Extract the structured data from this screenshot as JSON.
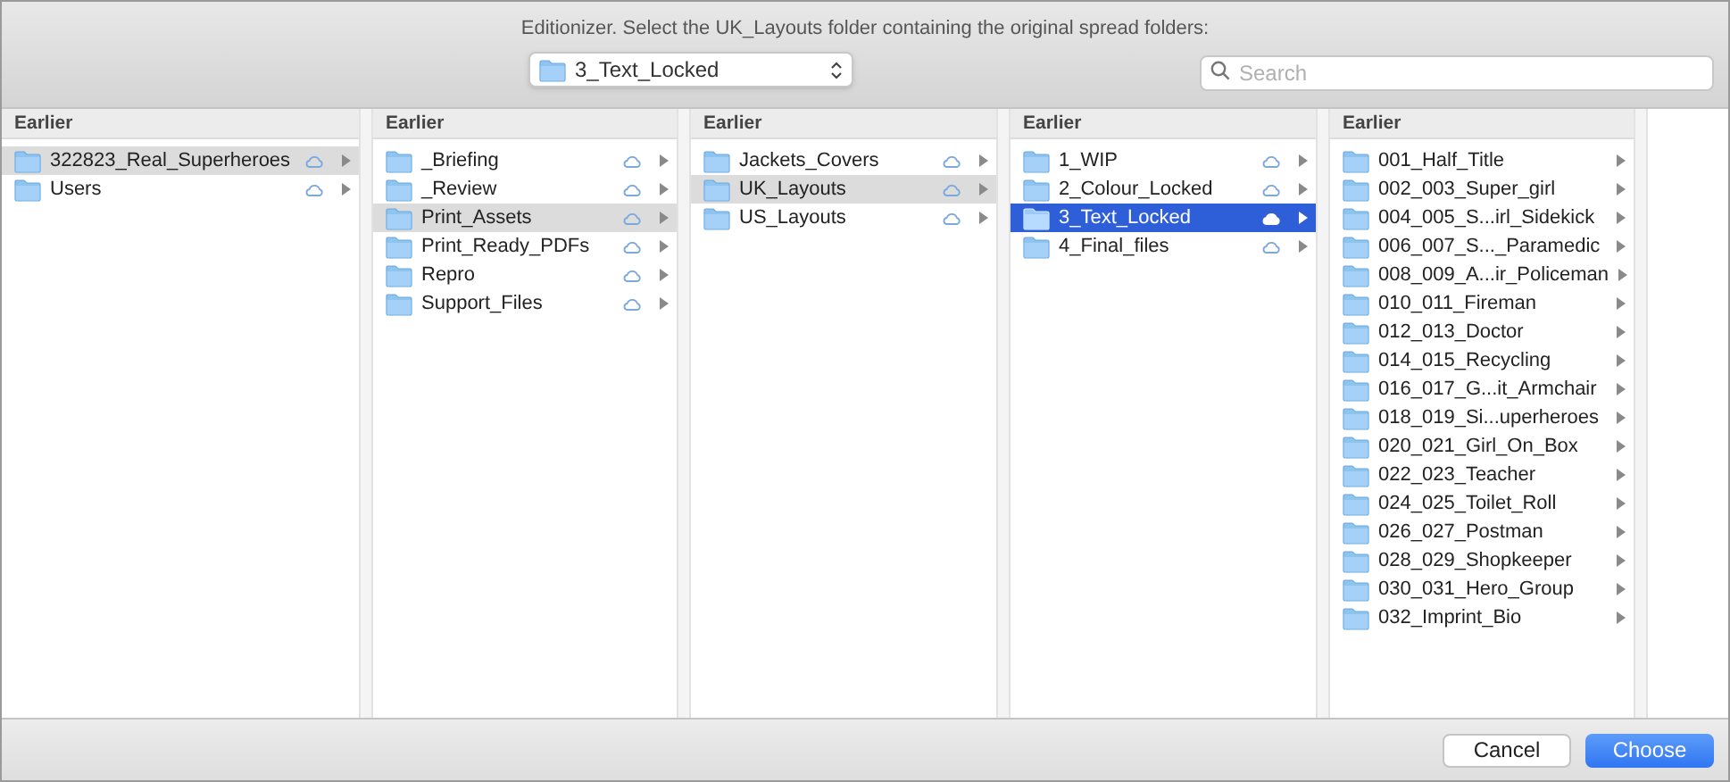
{
  "prompt": "Editionizer. Select the UK_Layouts folder containing the original spread folders:",
  "location_popup": {
    "value": "3_Text_Locked"
  },
  "search": {
    "placeholder": "Search"
  },
  "columns": [
    {
      "header": "Earlier",
      "focused": false,
      "items": [
        {
          "name": "322823_Real_Superheroes",
          "cloud": true,
          "selected": true
        },
        {
          "name": "Users",
          "cloud": true,
          "selected": false
        }
      ]
    },
    {
      "header": "Earlier",
      "focused": false,
      "items": [
        {
          "name": "_Briefing",
          "cloud": true,
          "selected": false
        },
        {
          "name": "_Review",
          "cloud": true,
          "selected": false
        },
        {
          "name": "Print_Assets",
          "cloud": true,
          "selected": true
        },
        {
          "name": "Print_Ready_PDFs",
          "cloud": true,
          "selected": false
        },
        {
          "name": "Repro",
          "cloud": true,
          "selected": false
        },
        {
          "name": "Support_Files",
          "cloud": true,
          "selected": false
        }
      ]
    },
    {
      "header": "Earlier",
      "focused": false,
      "items": [
        {
          "name": "Jackets_Covers",
          "cloud": true,
          "selected": false
        },
        {
          "name": "UK_Layouts",
          "cloud": true,
          "selected": true
        },
        {
          "name": "US_Layouts",
          "cloud": true,
          "selected": false
        }
      ]
    },
    {
      "header": "Earlier",
      "focused": true,
      "items": [
        {
          "name": "1_WIP",
          "cloud": true,
          "selected": false
        },
        {
          "name": "2_Colour_Locked",
          "cloud": true,
          "selected": false
        },
        {
          "name": "3_Text_Locked",
          "cloud": true,
          "selected": true
        },
        {
          "name": "4_Final_files",
          "cloud": true,
          "selected": false
        }
      ]
    },
    {
      "header": "Earlier",
      "items": [
        {
          "name": "001_Half_Title",
          "cloud": false,
          "selected": false
        },
        {
          "name": "002_003_Super_girl",
          "cloud": false,
          "selected": false
        },
        {
          "name": "004_005_S...irl_Sidekick",
          "cloud": false,
          "selected": false
        },
        {
          "name": "006_007_S..._Paramedic",
          "cloud": false,
          "selected": false
        },
        {
          "name": "008_009_A...ir_Policeman",
          "cloud": false,
          "selected": false
        },
        {
          "name": "010_011_Fireman",
          "cloud": false,
          "selected": false
        },
        {
          "name": "012_013_Doctor",
          "cloud": false,
          "selected": false
        },
        {
          "name": "014_015_Recycling",
          "cloud": false,
          "selected": false
        },
        {
          "name": "016_017_G...it_Armchair",
          "cloud": false,
          "selected": false
        },
        {
          "name": "018_019_Si...uperheroes",
          "cloud": false,
          "selected": false
        },
        {
          "name": "020_021_Girl_On_Box",
          "cloud": false,
          "selected": false
        },
        {
          "name": "022_023_Teacher",
          "cloud": false,
          "selected": false
        },
        {
          "name": "024_025_Toilet_Roll",
          "cloud": false,
          "selected": false
        },
        {
          "name": "026_027_Postman",
          "cloud": false,
          "selected": false
        },
        {
          "name": "028_029_Shopkeeper",
          "cloud": false,
          "selected": false
        },
        {
          "name": "030_031_Hero_Group",
          "cloud": false,
          "selected": false
        },
        {
          "name": "032_Imprint_Bio",
          "cloud": false,
          "selected": false
        }
      ]
    }
  ],
  "buttons": {
    "cancel": "Cancel",
    "choose": "Choose"
  }
}
